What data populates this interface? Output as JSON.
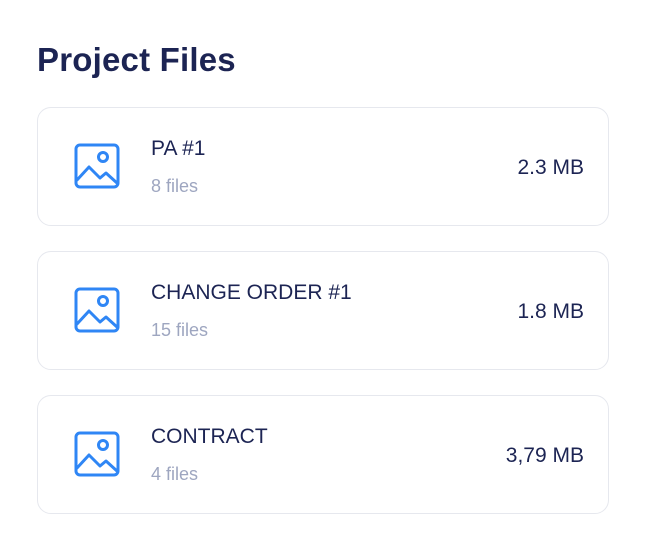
{
  "page": {
    "title": "Project Files"
  },
  "colors": {
    "accent": "#2f86f5",
    "text_primary": "#1c2453",
    "text_secondary": "#9ea6c0",
    "card_border": "#e6e8ee"
  },
  "files": [
    {
      "name": "PA #1",
      "count": "8 files",
      "size": "2.3 MB",
      "icon": "image-icon"
    },
    {
      "name": "CHANGE ORDER #1",
      "count": "15 files",
      "size": "1.8 MB",
      "icon": "image-icon"
    },
    {
      "name": "CONTRACT",
      "count": "4 files",
      "size": "3,79 MB",
      "icon": "image-icon"
    }
  ]
}
